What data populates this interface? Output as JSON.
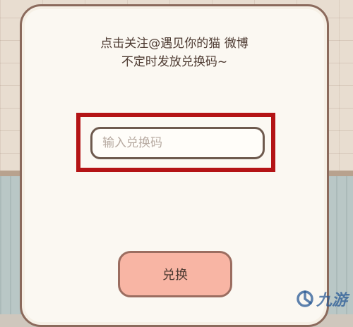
{
  "dialog": {
    "message_line1": "点击关注@遇见你的猫 微博",
    "message_line2": "不定时发放兑换码~"
  },
  "code_input": {
    "value": "",
    "placeholder": "输入兑换码"
  },
  "redeem_button": {
    "label": "兑换"
  },
  "watermark": {
    "text": "九游"
  },
  "colors": {
    "highlight": "#b41416",
    "button": "#f8b5a4",
    "panel": "#fbf8f2",
    "border": "#8b6a5c"
  }
}
